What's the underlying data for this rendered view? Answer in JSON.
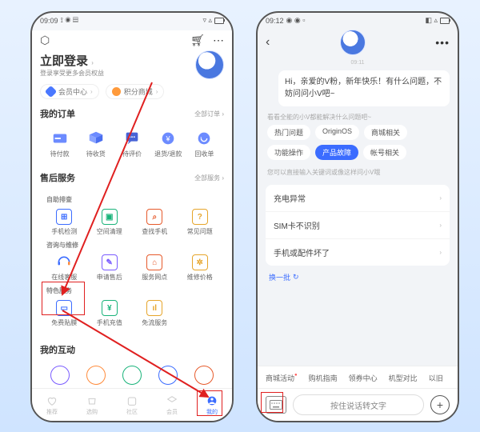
{
  "left": {
    "status_time": "09:09",
    "login_title": "立即登录",
    "login_sub": "登录享受更多会员权益",
    "pills": [
      "会员中心",
      "积分商城"
    ],
    "orders": {
      "title": "我的订单",
      "more": "全部订单 ›",
      "items": [
        "待付款",
        "待收货",
        "待评价",
        "退货/退款",
        "回收单"
      ]
    },
    "after": {
      "title": "售后服务",
      "more": "全部服务 ›",
      "sh1": "自助排查",
      "r1": [
        "手机检测",
        "空间清理",
        "查找手机",
        "常见问题"
      ],
      "sh2": "咨询与维修",
      "r2": [
        "在线客服",
        "申请售后",
        "服务网点",
        "维修价格"
      ],
      "sh3": "特色服务",
      "r3": [
        "免费贴膜",
        "手机充值",
        "免流服务",
        ""
      ]
    },
    "interact": "我的互动",
    "nav": [
      "推荐",
      "选购",
      "社区",
      "会员",
      "我的"
    ]
  },
  "right": {
    "status_time": "09:12",
    "ts": "09:11",
    "bubble": "Hi，亲爱的V粉，新年快乐！有什么问题，不妨问问小V吧~",
    "hint1": "看看全能的小V都能解决什么问题吧~",
    "chips": [
      "热门问题",
      "OriginOS",
      "商城相关",
      "功能操作",
      "产品故障",
      "帐号相关"
    ],
    "hint2": "您可以直接输入关键词或像这样问小V哦",
    "list": [
      "充电异常",
      "SIM卡不识别",
      "手机或配件坏了"
    ],
    "change": "换一批",
    "tabs": [
      "商城活动",
      "购机指南",
      "领券中心",
      "机型对比",
      "以旧"
    ],
    "mic": "按住说话转文字"
  }
}
